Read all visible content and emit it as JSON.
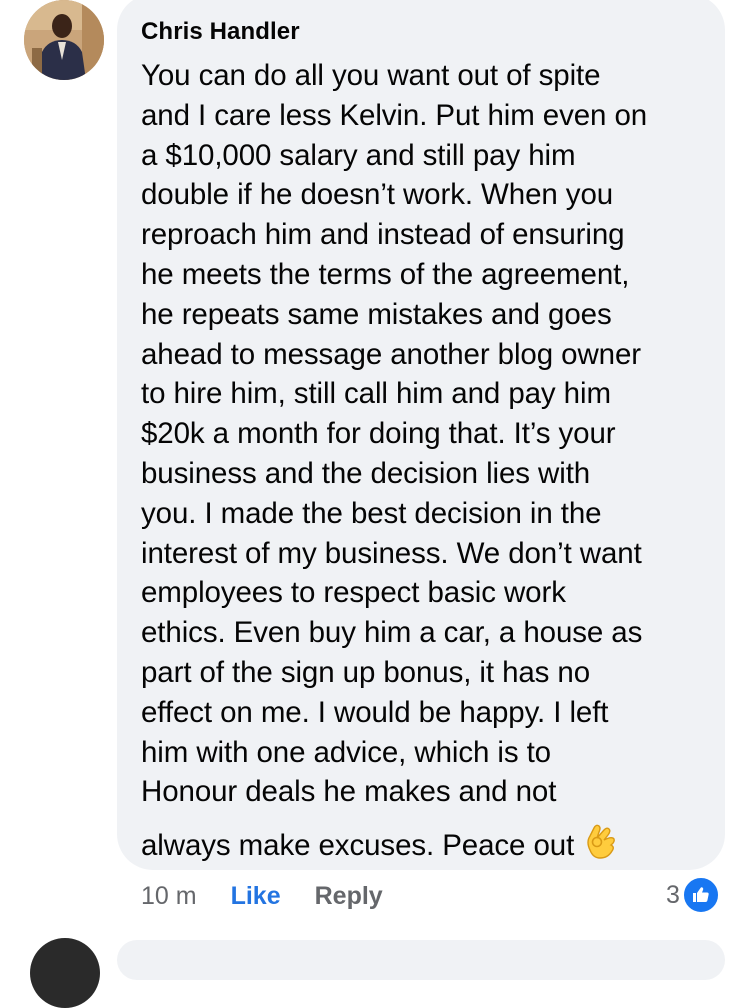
{
  "comment": {
    "author": "Chris Handler",
    "lines": [
      "You can do all you want out of spite",
      "and I care less Kelvin. Put him even on",
      "a $10,000 salary and still pay him",
      "double if he doesn’t work. When you",
      "reproach him and instead of ensuring",
      "he meets the terms of the agreement,",
      "he repeats same mistakes and goes",
      "ahead to message another blog owner",
      "to hire him, still call him and pay him",
      "$20k a month for doing that. It’s your",
      "business and the decision lies with",
      "you. I made the best decision in the",
      "interest of my business. We don’t want",
      "employees to respect basic work",
      "ethics. Even buy him a car, a house as",
      "part of the sign up bonus, it has no",
      "effect on me. I would be happy. I left",
      "him with one advice, which is to",
      "Honour deals he makes and not",
      "always make excuses. Peace out"
    ],
    "emoji": "ok-hand-emoji"
  },
  "actions": {
    "time": "10 m",
    "like_label": "Like",
    "reply_label": "Reply"
  },
  "reactions": {
    "count": "3",
    "icon": "thumbs-up-icon",
    "badge_color": "#1877f2"
  },
  "colors": {
    "bubble": "#f0f2f5",
    "link_blue": "#2374e1",
    "muted": "#65676b"
  }
}
